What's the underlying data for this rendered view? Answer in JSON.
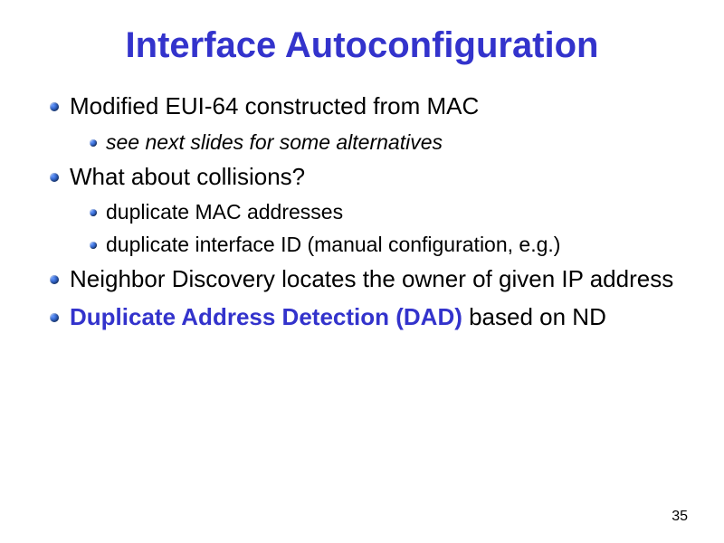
{
  "title": "Interface Autoconfiguration",
  "bullets": {
    "b1": "Modified EUI-64 constructed from MAC",
    "b1_1": "see next slides for some alternatives",
    "b2": "What about collisions?",
    "b2_1": "duplicate MAC addresses",
    "b2_2": "duplicate interface ID (manual configuration, e.g.)",
    "b3": "Neighbor Discovery locates the owner of given IP address",
    "b4_strong": "Duplicate Address Detection (DAD)",
    "b4_rest": " based on ND"
  },
  "page_number": "35"
}
